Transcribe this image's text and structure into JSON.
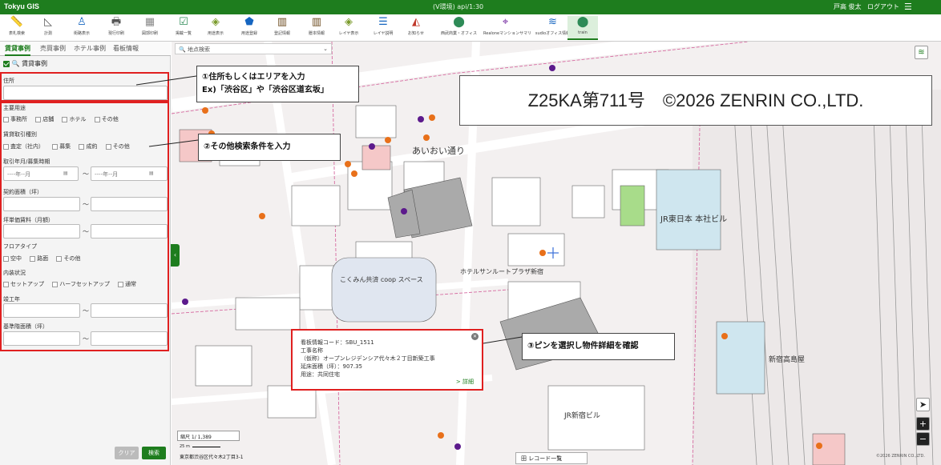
{
  "header": {
    "app_title": "Tokyu GIS",
    "env_label": "(V環境) api/1:30",
    "user_name": "戸高 俊太",
    "logout_label": "ログアウト"
  },
  "toolbar": {
    "tools": [
      {
        "label": "表札検索",
        "icon": "ruler-icon"
      },
      {
        "label": "計測",
        "icon": "triangle-ruler-icon"
      },
      {
        "label": "街路表示",
        "icon": "street-view-icon"
      },
      {
        "label": "現行印刷",
        "icon": "printer-icon"
      },
      {
        "label": "図郭印刷",
        "icon": "grid-icon"
      },
      {
        "label": "掲載一覧",
        "icon": "checklist-icon"
      },
      {
        "label": "用途表示",
        "icon": "layers-icon"
      },
      {
        "label": "用途登録",
        "icon": "pentagon-icon"
      },
      {
        "label": "登記情報",
        "icon": "register-book-icon"
      },
      {
        "label": "謄本情報",
        "icon": "register-book-icon"
      },
      {
        "label": "レイヤ表示",
        "icon": "layers-icon"
      },
      {
        "label": "レイヤ説明",
        "icon": "list-icon"
      },
      {
        "label": "お知らせ",
        "icon": "shapes-icon"
      },
      {
        "label": "西武商業・オフィス",
        "icon": "pin-icon"
      },
      {
        "label": "Realoneマンションサマリ",
        "icon": "crosshair-icon"
      },
      {
        "label": "sudioオフィス情報",
        "icon": "stack-icon"
      },
      {
        "label": "train",
        "icon": "train-icon"
      }
    ]
  },
  "sidebar": {
    "tabs": [
      "賃貸事例",
      "売買事例",
      "ホテル事例",
      "看板情報"
    ],
    "section_title": "賃貸事例",
    "address_label": "住所",
    "usage_label": "主要用途",
    "usage_options": [
      "事務所",
      "店舗",
      "ホテル",
      "その他"
    ],
    "txn_label": "賃貸取引種別",
    "txn_options": [
      "査定（社内）",
      "募集",
      "成約",
      "その他"
    ],
    "period_label": "取引年月/募集時期",
    "period_from_placeholder": "----年--月",
    "period_to_placeholder": "----年--月",
    "area_label": "契約面積（坪）",
    "unit_price_label": "坪単価賃料（月額）",
    "floor_type_label": "フロアタイプ",
    "floor_type_options": [
      "空中",
      "路面",
      "その他"
    ],
    "interior_label": "内装状況",
    "interior_options": [
      "セットアップ",
      "ハーフセットアップ",
      "通常"
    ],
    "year_label": "竣工年",
    "base_area_label": "基準階面積（坪）",
    "tilde": "～",
    "calendar_glyph": "▤",
    "clear_label": "クリア",
    "search_label": "検索"
  },
  "map": {
    "search_placeholder": "地点検索",
    "copyright": "Z25KA第711号　©2026 ZENRIN CO.,LTD.",
    "scale_value": "縮尺 1/ 1,389",
    "scale_bar_text": "25 m",
    "address_readout": "東京都渋谷区代々木2丁目3-1",
    "record_list_label": "田 レコード一覧",
    "zenrin_small": "©2026 ZENRIN CO.,LTD.",
    "place_labels": [
      "あいおい通り",
      "こくみん共済 coop スペース",
      "JR東日本 本社ビル",
      "ホテルサンルートプラザ新宿",
      "JR新宿ビル",
      "新宿高島屋"
    ]
  },
  "callouts": {
    "c1_line1": "①住所もしくはエリアを入力",
    "c1_line2": "Ex)「渋谷区」や「渋谷区道玄坂」",
    "c2": "②その他検索条件を入力",
    "c3": "③ピンを選択し物件詳細を確認"
  },
  "popup": {
    "code_line": "看板情報コード：SBU_1511",
    "name_label": "工事名称",
    "name_value": "（仮称）オープンレジデンシア代々木２丁目新築工事",
    "floor_area": "延床面積（坪）：907.35",
    "use": "用途：共同住宅",
    "detail_label": "> 詳細"
  },
  "colors": {
    "brand_green": "#1e7d1e",
    "highlight_red": "#e02020",
    "pin_orange": "#e8701a",
    "pin_purple": "#5c1a8c"
  }
}
